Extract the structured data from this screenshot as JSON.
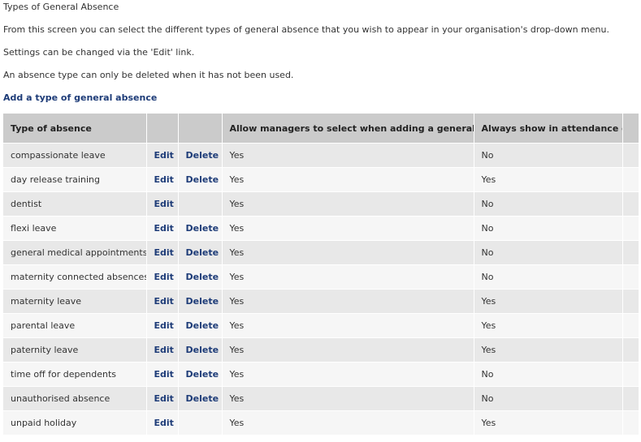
{
  "intro": {
    "title": "Types of General Absence",
    "line1": "From this screen you can select the different types of general absence that you wish to appear in your organisation's drop-down menu.",
    "line2": "Settings can be changed via the 'Edit' link.",
    "line3": "An absence type can only be deleted when it has not been used."
  },
  "add_link": "Add a type of general absence",
  "table": {
    "headers": {
      "type": "Type of absence",
      "allow": "Allow managers to select when adding a general absence",
      "always": "Always show in attendance chart"
    },
    "edit_label": "Edit",
    "delete_label": "Delete",
    "rows": [
      {
        "type": "compassionate leave",
        "edit": "Edit",
        "delete": "Delete",
        "allow": "Yes",
        "always": "No"
      },
      {
        "type": "day release training",
        "edit": "Edit",
        "delete": "Delete",
        "allow": "Yes",
        "always": "Yes"
      },
      {
        "type": "dentist",
        "edit": "Edit",
        "delete": "",
        "allow": "Yes",
        "always": "No"
      },
      {
        "type": "flexi leave",
        "edit": "Edit",
        "delete": "Delete",
        "allow": "Yes",
        "always": "No"
      },
      {
        "type": "general medical appointments",
        "edit": "Edit",
        "delete": "Delete",
        "allow": "Yes",
        "always": "No"
      },
      {
        "type": "maternity connected absences",
        "edit": "Edit",
        "delete": "Delete",
        "allow": "Yes",
        "always": "No"
      },
      {
        "type": "maternity leave",
        "edit": "Edit",
        "delete": "Delete",
        "allow": "Yes",
        "always": "Yes"
      },
      {
        "type": "parental leave",
        "edit": "Edit",
        "delete": "Delete",
        "allow": "Yes",
        "always": "Yes"
      },
      {
        "type": "paternity leave",
        "edit": "Edit",
        "delete": "Delete",
        "allow": "Yes",
        "always": "Yes"
      },
      {
        "type": "time off for dependents",
        "edit": "Edit",
        "delete": "Delete",
        "allow": "Yes",
        "always": "No"
      },
      {
        "type": "unauthorised absence",
        "edit": "Edit",
        "delete": "Delete",
        "allow": "Yes",
        "always": "No"
      },
      {
        "type": "unpaid holiday",
        "edit": "Edit",
        "delete": "",
        "allow": "Yes",
        "always": "Yes"
      }
    ]
  },
  "colors": {
    "link": "#1e3c78",
    "header_bg": "#cbcbcb",
    "row_odd": "#e8e8e8",
    "row_even": "#f6f6f6"
  }
}
